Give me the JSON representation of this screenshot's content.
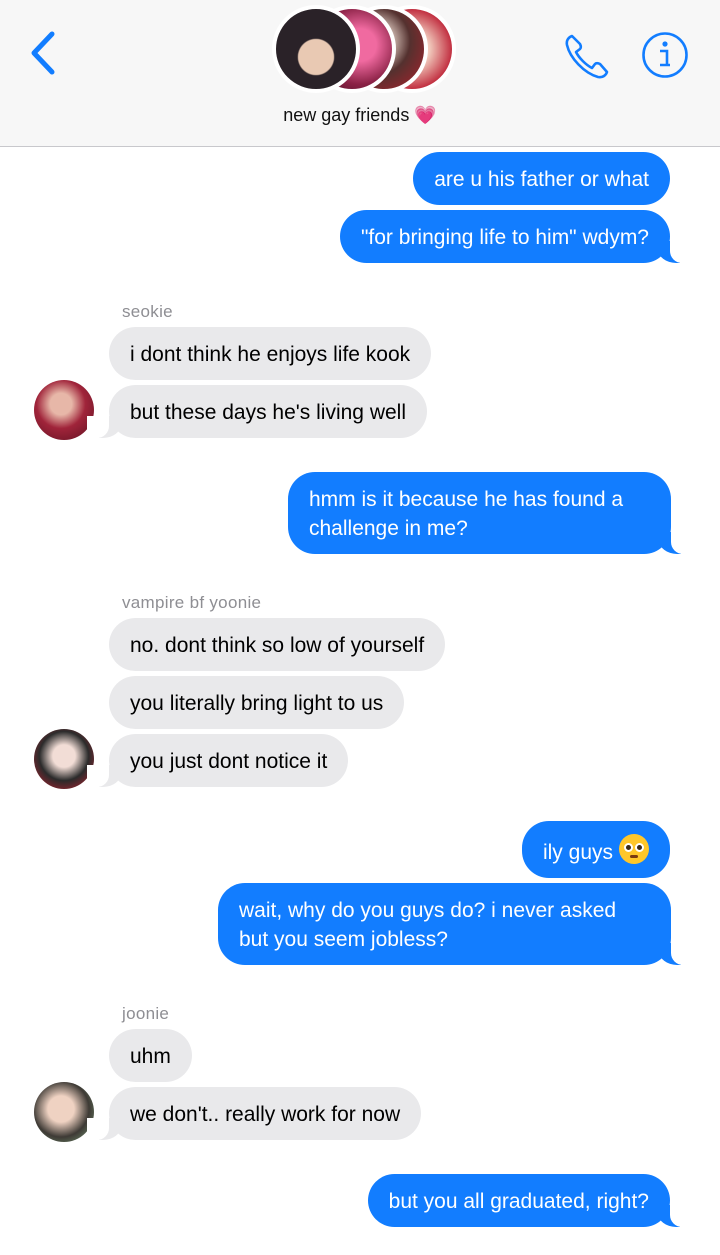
{
  "header": {
    "group_name": "new gay friends 💗",
    "back_icon": "chevron-left-icon",
    "call_icon": "phone-icon",
    "info_icon": "info-icon",
    "accent": "#127dff"
  },
  "messages": [
    {
      "from": "me",
      "text": "are u his father or what"
    },
    {
      "from": "me",
      "text": "\"for bringing life to him\" wdym?"
    },
    {
      "from": "seokie",
      "sender_label": "seokie",
      "text": "i dont think he enjoys life kook"
    },
    {
      "from": "seokie",
      "text": "but these days he's living well"
    },
    {
      "from": "me",
      "text": "hmm is it because he has found a challenge in me?"
    },
    {
      "from": "yoonie",
      "sender_label": "vampire bf yoonie",
      "text": "no. dont think so low of yourself"
    },
    {
      "from": "yoonie",
      "text": "you literally bring light to us"
    },
    {
      "from": "yoonie",
      "text": "you just dont notice it"
    },
    {
      "from": "me",
      "text": "ily guys",
      "emoji": "pleading-face-icon"
    },
    {
      "from": "me",
      "text": "wait, why do you guys do? i never asked but you seem jobless?"
    },
    {
      "from": "joonie",
      "sender_label": "joonie",
      "text": "uhm"
    },
    {
      "from": "joonie",
      "text": "we don't.. really work for now"
    },
    {
      "from": "me",
      "text": "but you all graduated, right?"
    }
  ],
  "colors": {
    "outgoing_bubble": "#127dff",
    "incoming_bubble": "#e9e9eb",
    "sender_label": "#8e8e93"
  }
}
